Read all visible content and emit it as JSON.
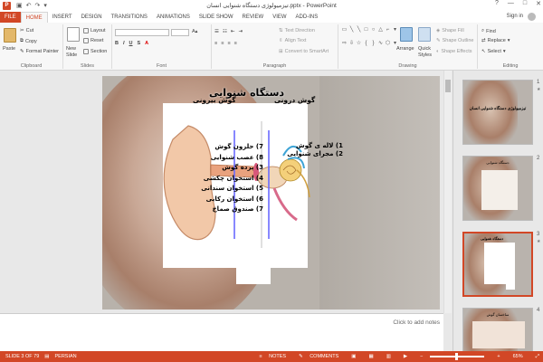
{
  "window": {
    "title": "تیزمیولوژی دستگاه شنوایی انسان.pptx - PowerPoint",
    "minimize": "—",
    "restore": "□",
    "close": "✕",
    "help": "?"
  },
  "tabs": [
    "FILE",
    "HOME",
    "INSERT",
    "DESIGN",
    "TRANSITIONS",
    "ANIMATIONS",
    "SLIDE SHOW",
    "REVIEW",
    "VIEW",
    "ADD-INS"
  ],
  "signin": "Sign in",
  "ribbon": {
    "clipboard": {
      "paste": "Paste",
      "cut": "Cut",
      "copy": "Copy",
      "format_painter": "Format Painter",
      "label": "Clipboard"
    },
    "slides": {
      "new_slide": "New",
      "new_slide2": "Slide",
      "layout": "Layout",
      "reset": "Reset",
      "section": "Section",
      "label": "Slides"
    },
    "font": {
      "label": "Font"
    },
    "paragraph": {
      "text_direction": "Text Direction",
      "align_text": "Align Text",
      "smartart": "Convert to SmartArt",
      "label": "Paragraph"
    },
    "drawing": {
      "arrange": "Arrange",
      "quick_styles": "Quick",
      "quick_styles2": "Styles",
      "shape_fill": "Shape Fill",
      "shape_outline": "Shape Outline",
      "shape_effects": "Shape Effects",
      "label": "Drawing"
    },
    "editing": {
      "find": "Find",
      "replace": "Replace",
      "select": "Select",
      "label": "Editing"
    }
  },
  "slide": {
    "title": "دستگاه شنوایی",
    "label_outer": "گوش بیرونی",
    "label_middle": "گوش درونی",
    "legend": [
      "1) لاله ی گوش",
      "2) مجرای شنوایی",
      "3) پرده گوش",
      "4) استخوان چکشی",
      "5) استخوان سندانی",
      "6) استخوان رکابی",
      "7) صندوق صماخ",
      "7) حلزون گوش",
      "8) عصب شنوایی"
    ]
  },
  "thumbnails": [
    {
      "num": "1",
      "title": "تیزمیولوژی دستگاه شنوایی انسان"
    },
    {
      "num": "2",
      "title": "دستگاه شنوایی"
    },
    {
      "num": "3",
      "title": "دستگاه شنوایی"
    },
    {
      "num": "4",
      "title": "ساختمان گوش"
    }
  ],
  "notes": {
    "placeholder": "Click to add notes"
  },
  "status": {
    "slide_of": "SLIDE 3 OF 79",
    "language": "PERSIAN",
    "notes": "NOTES",
    "comments": "COMMENTS",
    "zoom": "65%"
  },
  "colors": {
    "accent": "#d24726"
  }
}
